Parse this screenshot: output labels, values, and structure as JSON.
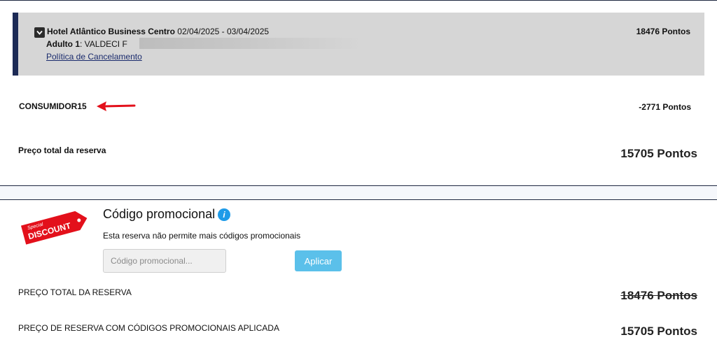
{
  "booking": {
    "hotel_name": "Hotel Atlântico Business Centro",
    "dates": "02/04/2025 - 03/04/2025",
    "guest_label": "Adulto 1",
    "guest_name": ": VALDECI F",
    "policy_link": "Política de Cancelamento",
    "points": "18476 Pontos"
  },
  "coupon": {
    "code": "CONSUMIDOR15",
    "points": "-2771 Pontos"
  },
  "total": {
    "label": "Preço total da reserva",
    "value": "15705 Pontos"
  },
  "promo": {
    "badge_top": "Special",
    "badge_main": "DISCOUNT",
    "title": "Código promocional",
    "info_glyph": "i",
    "note": "Esta reserva não permite mais códigos promocionais",
    "placeholder": "Código promocional...",
    "apply_label": "Aplicar"
  },
  "summary": {
    "total_label": "PREÇO TOTAL DA RESERVA",
    "total_value": "18476 Pontos",
    "discounted_label": "PREÇO DE RESERVA COM CÓDIGOS PROMOCIONAIS APLICADA",
    "discounted_value": "15705 Pontos"
  },
  "colors": {
    "accent": "#1c2a55",
    "apply_button": "#5bc0ea",
    "info_icon": "#1e9be8",
    "discount_tag": "#e3101b",
    "arrow": "#e3101b"
  },
  "icons": [
    "chevron-down-icon",
    "red-arrow-icon",
    "discount-tag-icon",
    "info-icon"
  ]
}
